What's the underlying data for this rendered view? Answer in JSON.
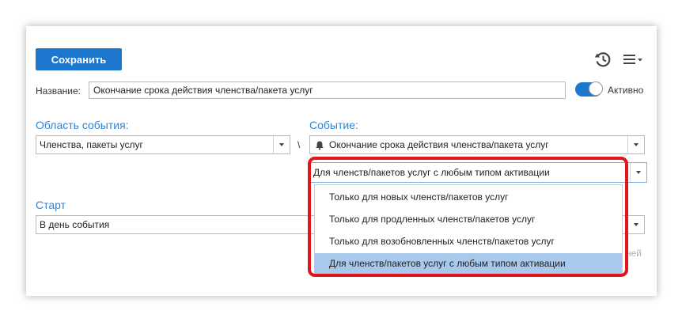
{
  "toolbar": {
    "save_label": "Сохранить"
  },
  "name_field": {
    "label": "Название:",
    "value": "Окончание срока действия членства/пакета услуг"
  },
  "active_toggle": {
    "label": "Активно",
    "on": true
  },
  "event_area": {
    "title": "Область события:",
    "value": "Членства, пакеты услуг"
  },
  "separator": "\\",
  "event": {
    "title": "Событие:",
    "value": "Окончание срока действия членства/пакета услуг"
  },
  "activation_select": {
    "value": "Для членств/пакетов услуг с любым типом активации",
    "options": [
      "Только для новых членств/пакетов услуг",
      "Только для продленных членств/пакетов услуг",
      "Только для возобновленных членств/пакетов услуг",
      "Для членств/пакетов услуг с любым типом активации"
    ],
    "selected_index": 3
  },
  "start": {
    "title": "Старт",
    "value": "В день события"
  },
  "hint_fragment": "ней",
  "colors": {
    "accent": "#1e77cf",
    "section_title": "#2a86d8",
    "highlight": "#e0161f",
    "selected_option": "#a8c9ec"
  }
}
